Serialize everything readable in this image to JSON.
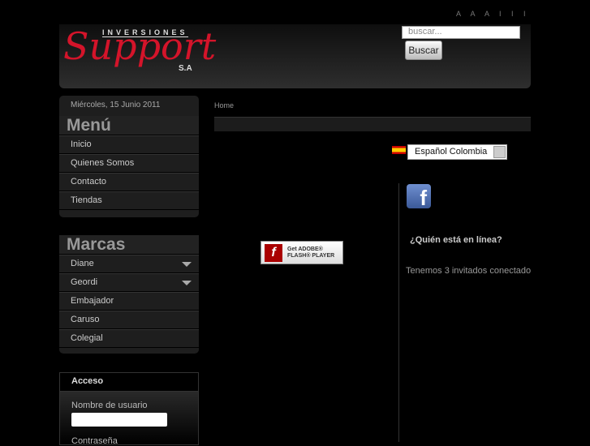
{
  "header": {
    "font_size_controls": "A A A I I I",
    "logo_top": "INVERSIONES",
    "logo_main": "Support",
    "logo_suffix": "S.A",
    "search_placeholder": "buscar...",
    "search_button": "Buscar"
  },
  "sidebar": {
    "date": "Miércoles, 15 Junio 2011",
    "menu_title": "Menú",
    "menu_items": [
      "Inicio",
      "Quienes Somos",
      "Contacto",
      "Tiendas"
    ],
    "brands_title": "Marcas",
    "brands": [
      "Diane",
      "Geordi",
      "Embajador",
      "Caruso",
      "Colegial"
    ],
    "login": {
      "title": "Acceso",
      "username_label": "Nombre de usuario",
      "password_label": "Contraseña"
    }
  },
  "main": {
    "breadcrumb": "Home",
    "flash": {
      "line1": "Get ADOBE®",
      "line2": "FLASH® PLAYER"
    }
  },
  "right": {
    "language": "Español Colombia",
    "online_title": "¿Quién está en línea?",
    "online_text": "Tenemos 3 invitados conectados"
  }
}
